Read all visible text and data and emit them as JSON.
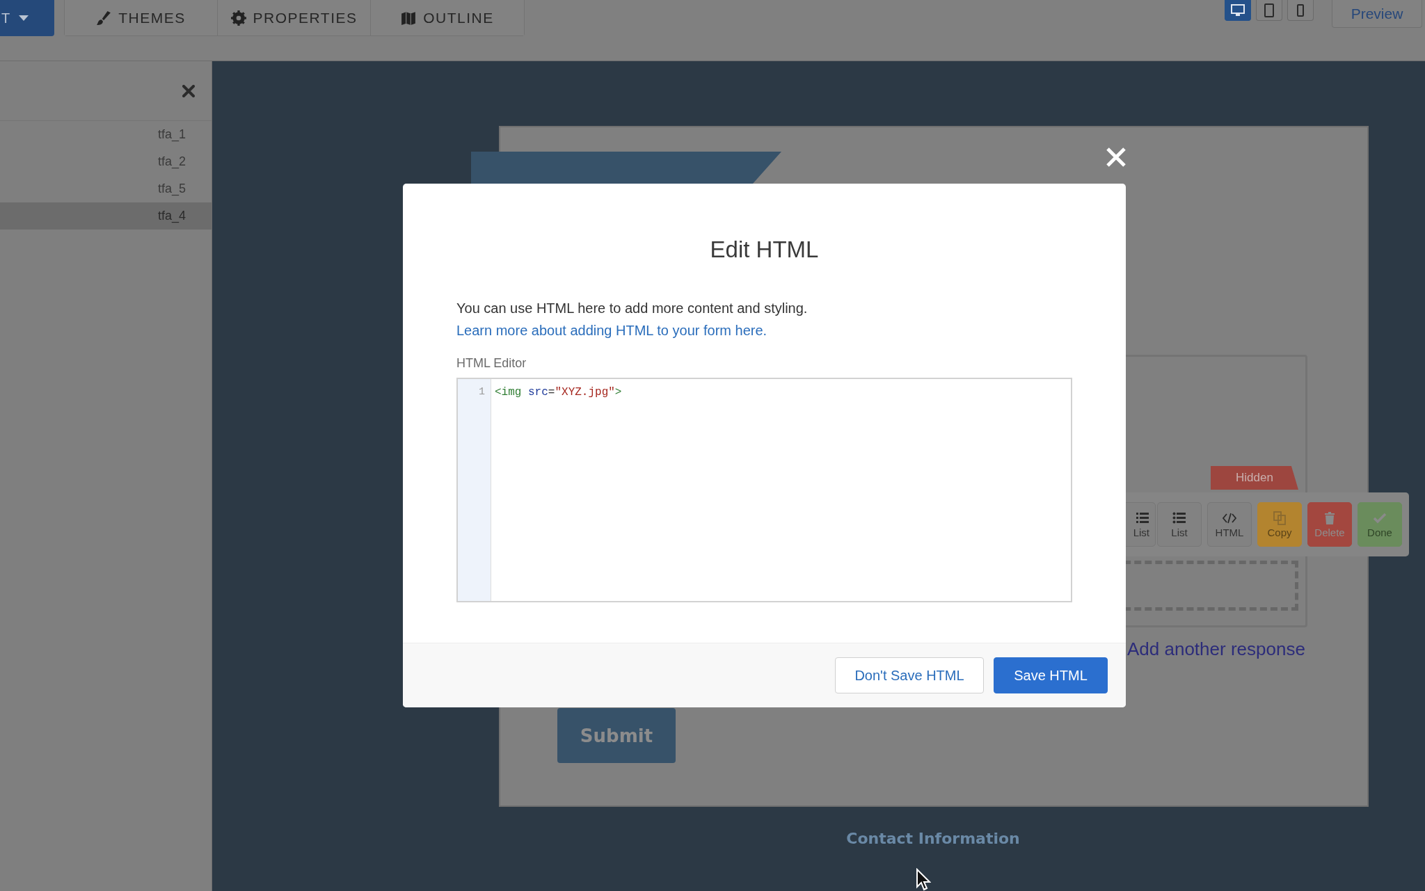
{
  "top_bar": {
    "menu_button": {
      "label": "T"
    },
    "tabs": [
      {
        "kind": "brush",
        "label": "THEMES"
      },
      {
        "kind": "gear",
        "label": "PROPERTIES"
      },
      {
        "kind": "map",
        "label": "OUTLINE"
      }
    ],
    "devices": [
      {
        "kind": "desktop",
        "selected": true
      },
      {
        "kind": "tablet",
        "selected": false
      },
      {
        "kind": "phone",
        "selected": false
      }
    ],
    "preview_button": "Preview"
  },
  "sidebar": {
    "items": [
      {
        "label": "tfa_1",
        "selected": false
      },
      {
        "label": "tfa_2",
        "selected": false
      },
      {
        "label": "tfa_5",
        "selected": false
      },
      {
        "label": "tfa_4",
        "selected": true
      }
    ]
  },
  "form": {
    "field_tag": "Hidden",
    "field_toolbar": [
      {
        "kind": "numbered-list",
        "label": "List"
      },
      {
        "kind": "bullet-list",
        "label": "List"
      },
      {
        "kind": "html",
        "label": "HTML"
      },
      {
        "kind": "copy",
        "label": "Copy"
      },
      {
        "kind": "delete",
        "label": "Delete"
      },
      {
        "kind": "done",
        "label": "Done"
      }
    ],
    "add_link": "Add another response",
    "submit_button": "Submit"
  },
  "footer_heading": "Contact Information",
  "modal": {
    "title": "Edit HTML",
    "intro": "You can use HTML here to add more content and styling.",
    "link": "Learn more about adding HTML to your form here.",
    "editor_label": "HTML Editor",
    "code_lines": [
      {
        "number": "1",
        "tokens": [
          {
            "kind": "tag",
            "text": "<img"
          },
          {
            "kind": "attr",
            "text": " src"
          },
          {
            "kind": "plain",
            "text": "="
          },
          {
            "kind": "string",
            "text": "\"XYZ.jpg\""
          },
          {
            "kind": "tag",
            "text": ">"
          }
        ]
      }
    ],
    "buttons": [
      {
        "kind": "secondary",
        "label": "Don't Save HTML"
      },
      {
        "kind": "primary",
        "label": "Save HTML"
      }
    ]
  }
}
